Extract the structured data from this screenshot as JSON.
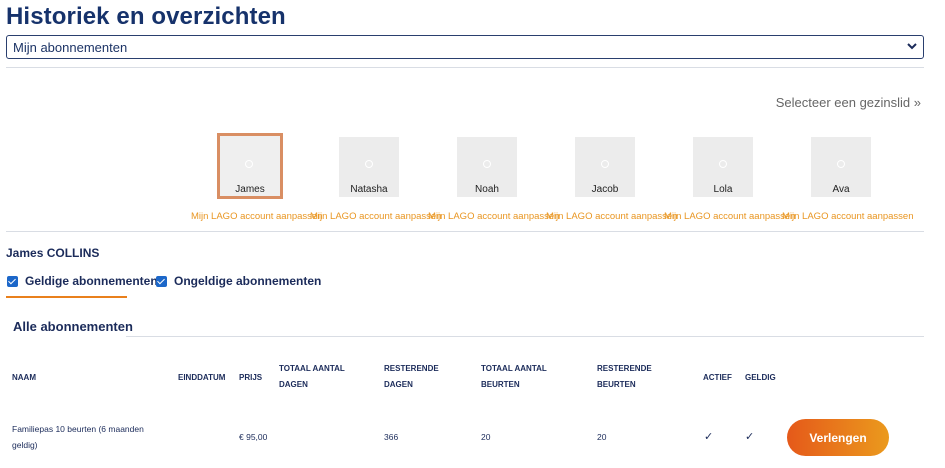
{
  "page": {
    "title": "Historiek en overzichten"
  },
  "selector": {
    "value": "Mijn abonnementen"
  },
  "family": {
    "select_label": "Selecteer een gezinslid »",
    "edit_label": "Mijn LAGO account aanpassen",
    "members": [
      {
        "name": "James",
        "selected": true
      },
      {
        "name": "Natasha",
        "selected": false
      },
      {
        "name": "Noah",
        "selected": false
      },
      {
        "name": "Jacob",
        "selected": false
      },
      {
        "name": "Lola",
        "selected": false
      },
      {
        "name": "Ava",
        "selected": false
      }
    ]
  },
  "user": {
    "full_name": "James COLLINS"
  },
  "filters": {
    "valid_label": "Geldige abonnementen",
    "invalid_label": "Ongeldige abonnementen"
  },
  "section": {
    "title": "Alle abonnementen"
  },
  "table": {
    "headers": {
      "naam": "NAAM",
      "einddatum": "EINDDATUM",
      "prijs": "PRIJS",
      "totaal_dagen": [
        "TOTAAL AANTAL",
        "DAGEN"
      ],
      "resterende_dagen": [
        "RESTERENDE",
        "DAGEN"
      ],
      "totaal_beurten": [
        "TOTAAL AANTAL",
        "BEURTEN"
      ],
      "resterende_beurten": [
        "RESTERENDE",
        "BEURTEN"
      ],
      "actief": "ACTIEF",
      "geldig": "GELDIG"
    },
    "rows": [
      {
        "naam": [
          "Familiepas 10 beurten (6 maanden",
          "geldig)"
        ],
        "einddatum": "",
        "prijs": "€ 95,00",
        "totaal_dagen": "",
        "resterende_dagen": "366",
        "totaal_beurten": "20",
        "resterende_beurten": "20",
        "actief": "✓",
        "geldig": "✓",
        "action_label": "Verlengen"
      }
    ]
  },
  "colors": {
    "title": "#16326b",
    "accent_orange": "#e9801c",
    "link_orange": "#e99622",
    "checkbox_blue": "#1c67c9"
  }
}
